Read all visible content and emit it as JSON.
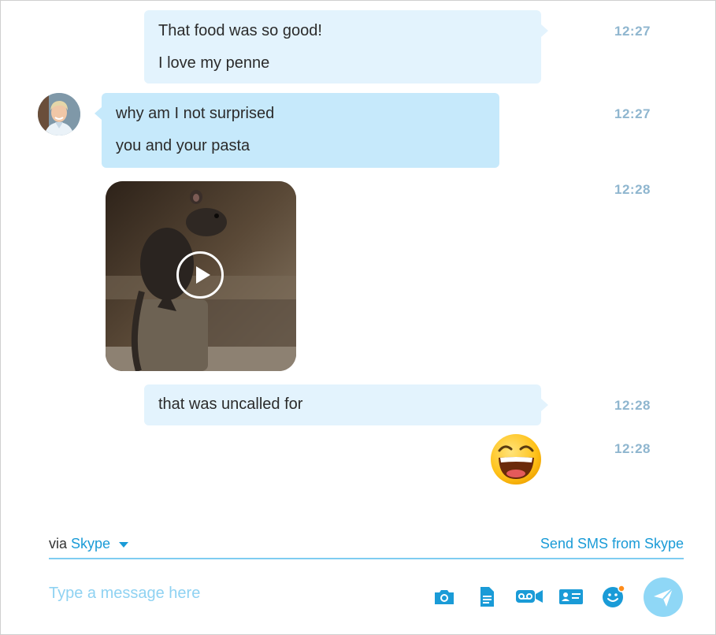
{
  "messages": [
    {
      "direction": "outgoing",
      "lines": [
        "That food was so good!",
        "I love my penne"
      ],
      "time": "12:27"
    },
    {
      "direction": "incoming",
      "lines": [
        "why am I not surprised",
        "you and your pasta"
      ],
      "time": "12:27"
    },
    {
      "direction": "incoming",
      "type": "video",
      "time": "12:28"
    },
    {
      "direction": "outgoing",
      "lines": [
        "that was uncalled for"
      ],
      "time": "12:28"
    },
    {
      "direction": "outgoing",
      "type": "emoji",
      "emoji": "laughing-emoji",
      "time": "12:28"
    }
  ],
  "footer": {
    "via_prefix": "via",
    "via_service": "Skype",
    "sms_link": "Send SMS from Skype"
  },
  "composer": {
    "placeholder": "Type a message here",
    "value": ""
  },
  "toolbar": {
    "icons": [
      "gallery-icon",
      "file-icon",
      "video-message-icon",
      "contact-card-icon",
      "emoticon-icon",
      "send-icon"
    ]
  },
  "colors": {
    "accent": "#1a9bd7",
    "outgoing_bubble": "#e3f3fd",
    "incoming_bubble": "#c6e9fb",
    "timestamp": "#8fb6cf",
    "placeholder": "#8fd2f2",
    "send_button": "#8fd7f6"
  }
}
